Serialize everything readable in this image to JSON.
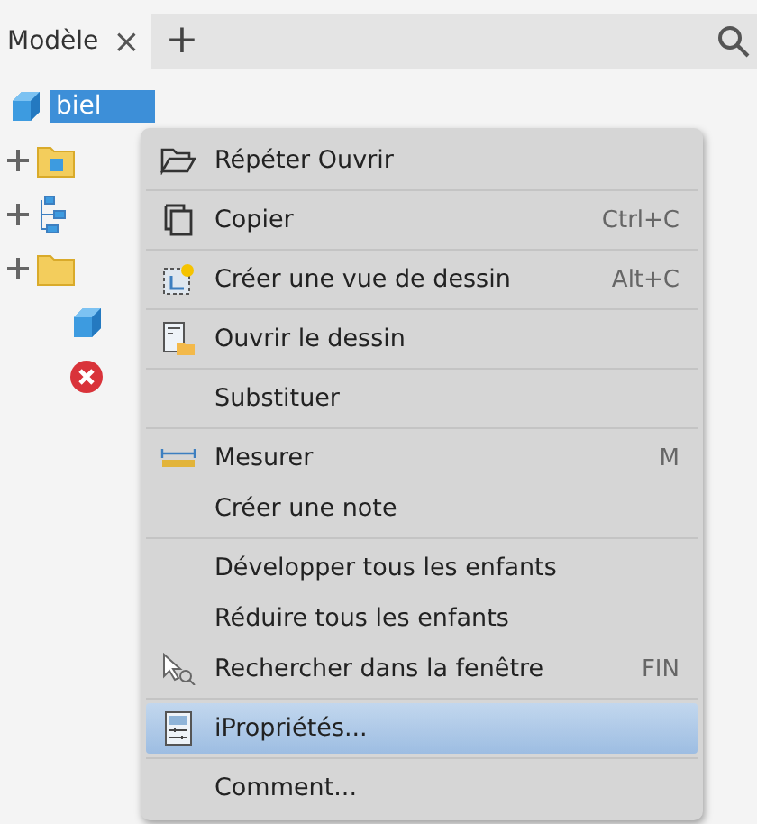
{
  "tab_bar": {
    "tab": {
      "label": "Modèle",
      "selected": true
    },
    "close": "×",
    "add": "+"
  },
  "tree": {
    "items": [
      {
        "kind": "part",
        "label": "biel",
        "selected": true
      },
      {
        "kind": "folder-part",
        "expandable": true
      },
      {
        "kind": "hierarchy",
        "expandable": true
      },
      {
        "kind": "folder",
        "expandable": true
      },
      {
        "kind": "part",
        "expandable": false
      },
      {
        "kind": "error",
        "expandable": false
      }
    ]
  },
  "context_menu": {
    "groups": [
      [
        {
          "label": "Répéter Ouvrir",
          "selected": false
        }
      ],
      [
        {
          "label": "Copier",
          "shortcut": "Ctrl+C",
          "selected": false
        }
      ],
      [
        {
          "label": "Créer une vue de dessin",
          "shortcut": "Alt+C",
          "selected": false
        }
      ],
      [
        {
          "label": "Ouvrir le dessin",
          "selected": false
        }
      ],
      [
        {
          "label": "Substituer",
          "selected": false
        }
      ],
      [
        {
          "label": "Mesurer",
          "shortcut": "M",
          "selected": false
        },
        {
          "label": "Créer une note",
          "selected": false
        }
      ],
      [
        {
          "label": "Développer tous les enfants",
          "selected": false
        },
        {
          "label": "Réduire tous les enfants",
          "selected": false
        },
        {
          "label": "Rechercher dans la fenêtre",
          "shortcut": "FIN",
          "selected": false
        }
      ],
      [
        {
          "label": "iPropriétés...",
          "selected": true
        }
      ],
      [
        {
          "label": "Comment...",
          "selected": false
        }
      ]
    ]
  }
}
